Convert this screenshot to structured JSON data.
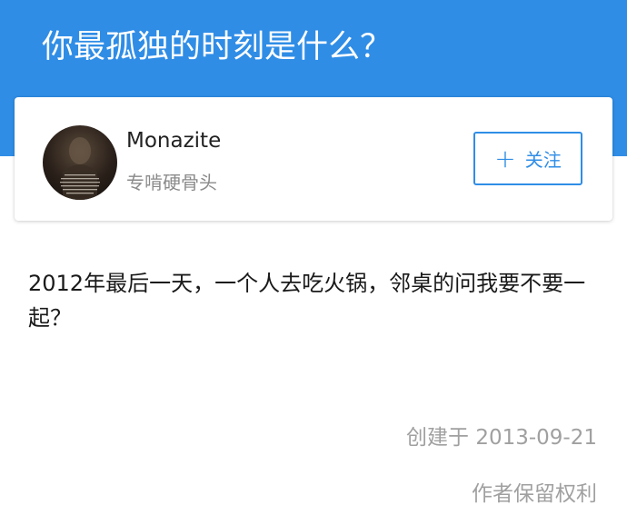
{
  "question": {
    "title": "你最孤独的时刻是什么？"
  },
  "author": {
    "name": "Monazite",
    "bio": "专啃硬骨头",
    "avatar_icon": "author-avatar",
    "follow_label": "关注",
    "follow_icon": "plus-icon"
  },
  "answer": {
    "text": "2012年最后一天，一个人去吃火锅，邻桌的问我要不要一起？",
    "created": "创建于 2013-09-21",
    "copyright": "作者保留权利"
  },
  "colors": {
    "accent": "#2f8de6",
    "muted": "#a0a0a0"
  }
}
